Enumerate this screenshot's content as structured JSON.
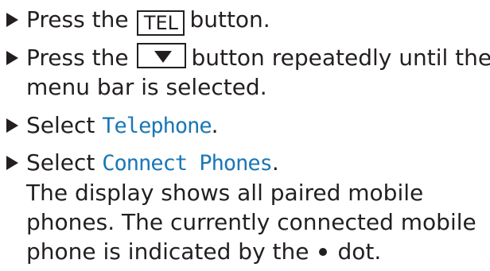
{
  "steps": [
    {
      "prefix": "Press the",
      "key": "TEL",
      "suffix": "button."
    },
    {
      "prefix": "Press the",
      "key_icon": "down-arrow-triangle",
      "suffix": "button repeatedly until the",
      "line2": "menu bar is selected."
    },
    {
      "prefix": "Select",
      "term": "Telephone",
      "suffix": "."
    },
    {
      "prefix": "Select",
      "term": "Connect Phones",
      "suffix": ".",
      "desc_line1": "The display shows all paired mobile",
      "desc_line2": "phones. The currently connected mobile",
      "desc_line3_before": "phone is indicated by the",
      "desc_line3_after": "dot."
    }
  ],
  "colors": {
    "text": "#231f20",
    "display_term": "#1a77b7"
  }
}
